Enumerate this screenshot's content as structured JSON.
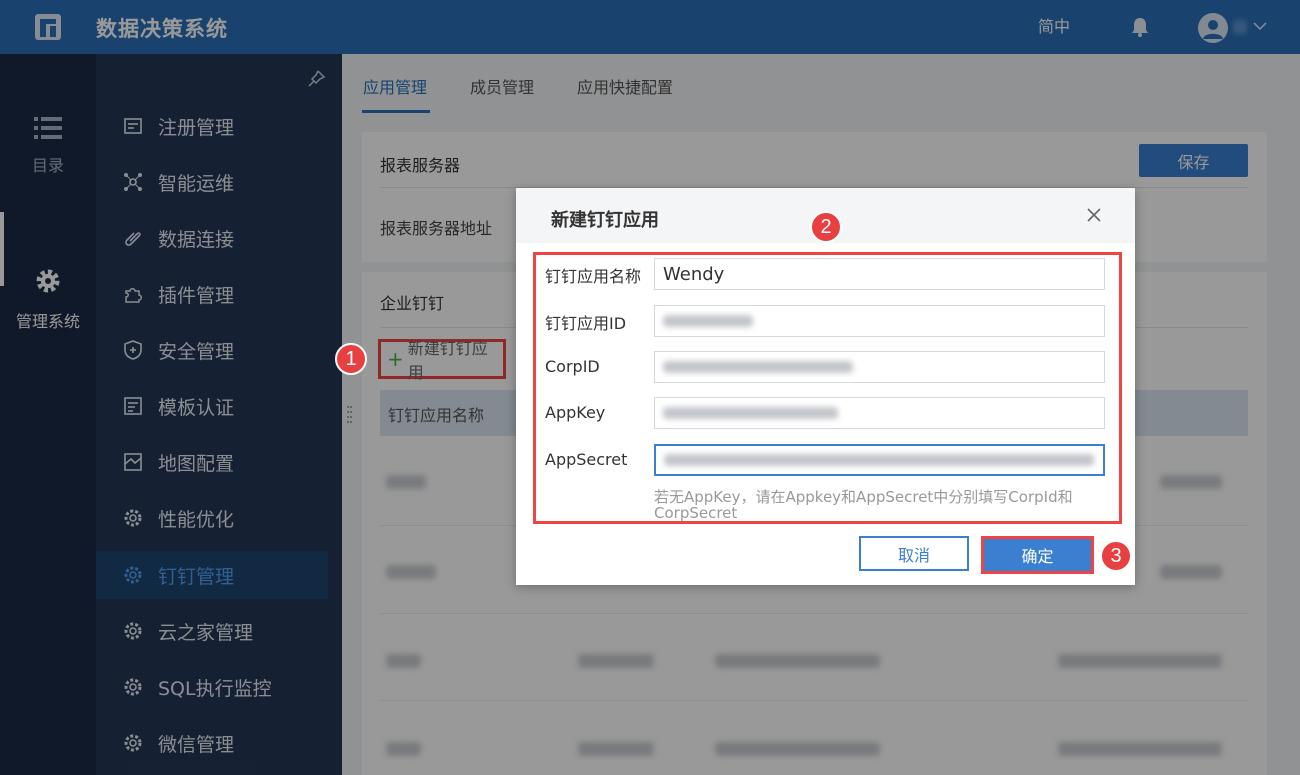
{
  "header": {
    "app_title": "数据决策系统",
    "language": "简中"
  },
  "rail": {
    "items": [
      {
        "label": "目录",
        "icon": "list-icon"
      },
      {
        "label": "管理系统",
        "icon": "gear-icon"
      }
    ]
  },
  "menu": {
    "items": [
      {
        "label": "注册管理",
        "icon": "register-icon"
      },
      {
        "label": "智能运维",
        "icon": "network-icon"
      },
      {
        "label": "数据连接",
        "icon": "link-icon"
      },
      {
        "label": "插件管理",
        "icon": "plugin-icon"
      },
      {
        "label": "安全管理",
        "icon": "shield-icon"
      },
      {
        "label": "模板认证",
        "icon": "template-icon"
      },
      {
        "label": "地图配置",
        "icon": "map-icon"
      },
      {
        "label": "性能优化",
        "icon": "gear-icon"
      },
      {
        "label": "钉钉管理",
        "icon": "gear-icon",
        "active": true
      },
      {
        "label": "云之家管理",
        "icon": "gear-icon"
      },
      {
        "label": "SQL执行监控",
        "icon": "gear-icon"
      },
      {
        "label": "微信管理",
        "icon": "gear-icon"
      }
    ]
  },
  "tabs": [
    "应用管理",
    "成员管理",
    "应用快捷配置"
  ],
  "page": {
    "server_label": "报表服务器",
    "save_label": "保存",
    "server_addr_label": "报表服务器地址",
    "enterprise_label": "企业钉钉",
    "new_app_label": "新建钉钉应用",
    "table_header_name": "钉钉应用名称"
  },
  "dialog": {
    "title": "新建钉钉应用",
    "fields": [
      {
        "label": "钉钉应用名称",
        "value": "Wendy"
      },
      {
        "label": "钉钉应用ID",
        "value": ""
      },
      {
        "label": "CorpID",
        "value": ""
      },
      {
        "label": "AppKey",
        "value": ""
      },
      {
        "label": "AppSecret",
        "value": ""
      }
    ],
    "hint": "若无AppKey，请在Appkey和AppSecret中分别填写CorpId和CorpSecret",
    "cancel_label": "取消",
    "ok_label": "确定"
  },
  "annotations": [
    "1",
    "2",
    "3"
  ],
  "colors": {
    "header_blue": "#2a70b8",
    "rail_bg": "#1c2b47",
    "menu_bg": "#243756",
    "active_text": "#4fa0f2",
    "accent_blue": "#3a7fd0",
    "annotation_red": "#e84040"
  }
}
